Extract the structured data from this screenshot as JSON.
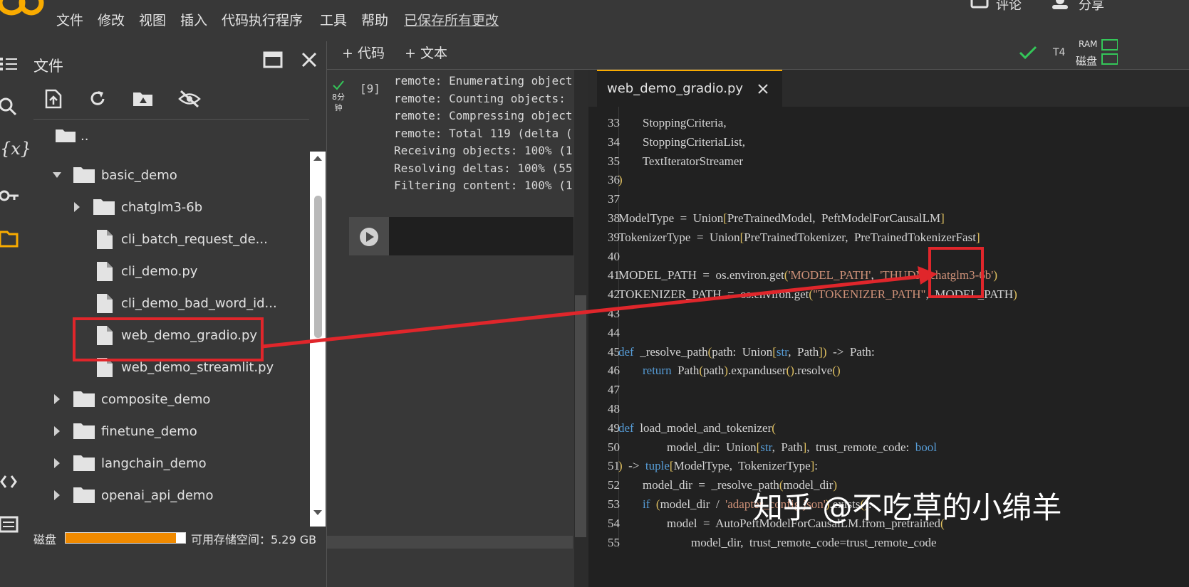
{
  "menu": {
    "file": "文件",
    "edit": "修改",
    "view": "视图",
    "insert": "插入",
    "runtime": "代码执行程序",
    "tools": "工具",
    "help": "帮助",
    "saved": "已保存所有更改"
  },
  "top_right": {
    "comment": "评论",
    "share": "分享"
  },
  "file_panel": {
    "title": "文件",
    "parent": "..",
    "items": [
      {
        "label": "basic_demo",
        "kind": "folder",
        "expanded": true
      },
      {
        "label": "chatglm3-6b",
        "kind": "folder"
      },
      {
        "label": "cli_batch_request_de...",
        "kind": "file"
      },
      {
        "label": "cli_demo.py",
        "kind": "file"
      },
      {
        "label": "cli_demo_bad_word_id...",
        "kind": "file"
      },
      {
        "label": "web_demo_gradio.py",
        "kind": "file"
      },
      {
        "label": "web_demo_streamlit.py",
        "kind": "file"
      },
      {
        "label": "composite_demo",
        "kind": "folder"
      },
      {
        "label": "finetune_demo",
        "kind": "folder"
      },
      {
        "label": "langchain_demo",
        "kind": "folder"
      },
      {
        "label": "openai_api_demo",
        "kind": "folder"
      }
    ],
    "storage_label": "磁盘",
    "storage_text": "可用存储空间：5.29 GB",
    "storage_used_fraction": 0.92
  },
  "notebook": {
    "add_code": "+ 代码",
    "add_text": "+ 文本",
    "runtime_type": "T4",
    "ram_label": "RAM",
    "disk_label": "磁盘",
    "cell_time": "8分钟",
    "cell_index": "[9]",
    "output_lines": [
      "remote: Enumerating object",
      "remote: Counting objects: ",
      "remote: Compressing object",
      "remote: Total 119 (delta (",
      "Receiving objects: 100% (1",
      "Resolving deltas: 100% (55",
      "Filtering content: 100% (1"
    ]
  },
  "editor": {
    "tab_name": "web_demo_gradio.py",
    "lines": [
      {
        "n": "33",
        "t": "        StoppingCriteria,"
      },
      {
        "n": "34",
        "t": "        StoppingCriteriaList,"
      },
      {
        "n": "35",
        "t": "        TextIteratorStreamer"
      },
      {
        "n": "36",
        "t": ")"
      },
      {
        "n": "37",
        "t": ""
      },
      {
        "n": "38",
        "t": "ModelType  =  Union[PreTrainedModel,  PeftModelForCausalLM]"
      },
      {
        "n": "39",
        "t": "TokenizerType  =  Union[PreTrainedTokenizer,  PreTrainedTokenizerFast]"
      },
      {
        "n": "40",
        "t": ""
      },
      {
        "n": "41",
        "t": "MODEL_PATH  =  os.environ.get('MODEL_PATH',  'THUDM/chatglm3-6b')"
      },
      {
        "n": "42",
        "t": "TOKENIZER_PATH  =  os.environ.get(\"TOKENIZER_PATH\",  MODEL_PATH)"
      },
      {
        "n": "43",
        "t": ""
      },
      {
        "n": "44",
        "t": ""
      },
      {
        "n": "45",
        "t": "def  _resolve_path(path:  Union[str,  Path])  ->  Path:"
      },
      {
        "n": "46",
        "t": "        return  Path(path).expanduser().resolve()"
      },
      {
        "n": "47",
        "t": ""
      },
      {
        "n": "48",
        "t": ""
      },
      {
        "n": "49",
        "t": "def  load_model_and_tokenizer("
      },
      {
        "n": "50",
        "t": "                model_dir:  Union[str,  Path],  trust_remote_code:  bool"
      },
      {
        "n": "51",
        "t": ")  ->  tuple[ModelType,  TokenizerType]:"
      },
      {
        "n": "52",
        "t": "        model_dir  =  _resolve_path(model_dir)"
      },
      {
        "n": "53",
        "t": "        if  (model_dir  /  'adapter_config.json').exists():"
      },
      {
        "n": "54",
        "t": "                model  =  AutoPeftModelForCausalLM.from_pretrained("
      },
      {
        "n": "55",
        "t": "                        model_dir,  trust_remote_code=trust_remote_code"
      }
    ]
  },
  "watermark": "知乎 @不吃草的小绵羊",
  "colors": {
    "highlight": "#e0262b",
    "keyword": "#569cd6",
    "string": "#ce9178",
    "storage_bar": "#f08a00"
  }
}
